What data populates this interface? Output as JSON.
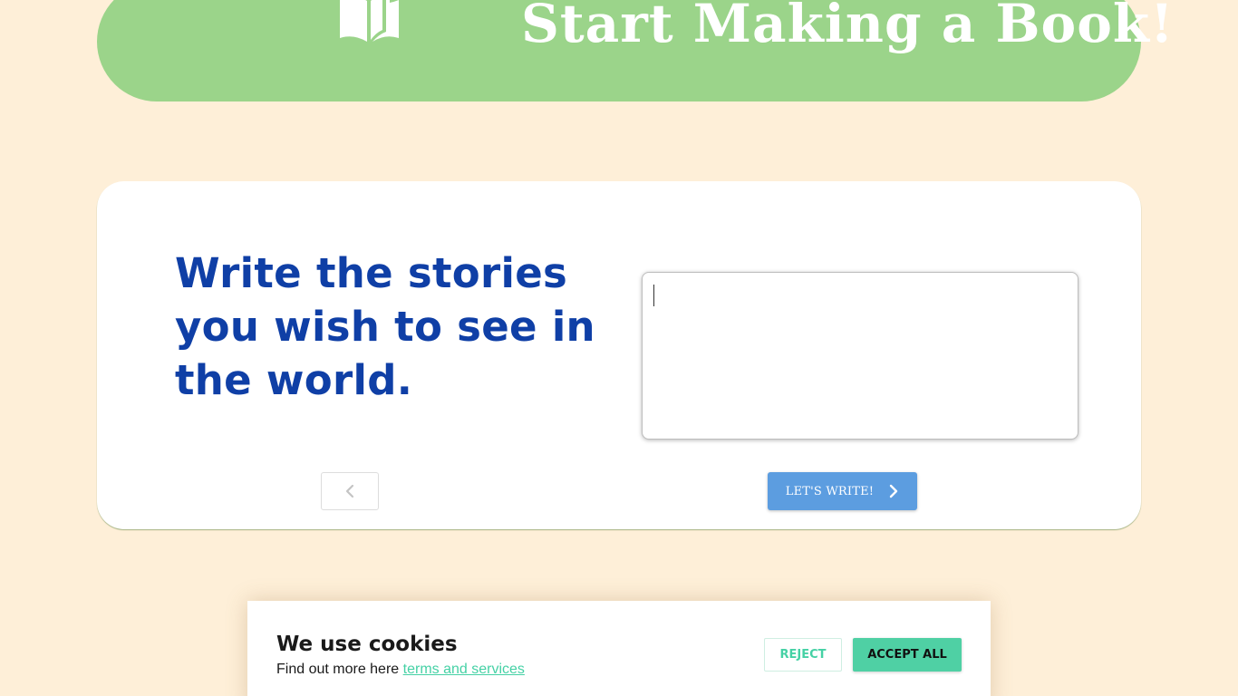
{
  "header": {
    "icon": "open-book-icon",
    "title": "Start Making a Book!"
  },
  "card": {
    "headline": "Write the stories you wish to see in the world.",
    "story_input": {
      "value": "",
      "placeholder": ""
    },
    "prev_icon": "chevron-left-icon",
    "next_label": "LET'S WRITE!",
    "next_icon": "chevron-right-icon"
  },
  "cookie_banner": {
    "title": "We use cookies",
    "text": "Find out more here",
    "link_text": "terms and services",
    "reject_label": "REJECT",
    "accept_label": "ACCEPT ALL"
  },
  "colors": {
    "background": "#feefd8",
    "header": "#9bd48a",
    "headline": "#0f3fa6",
    "primary_button": "#5c9de0",
    "cookie_accent": "#4fd0a4"
  }
}
